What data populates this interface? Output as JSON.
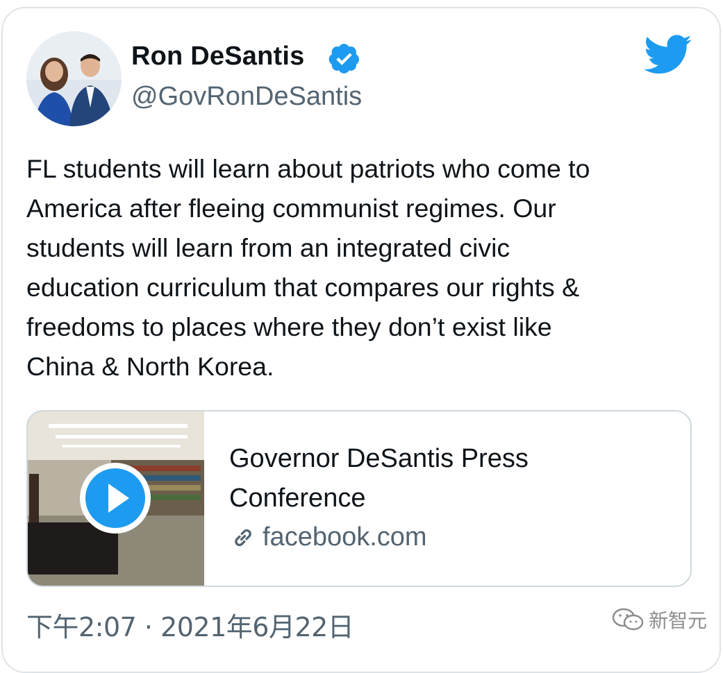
{
  "tweet": {
    "author_name": "Ron DeSantis",
    "handle": "@GovRonDeSantis",
    "verified": true,
    "lines": [
      "FL students will learn about patriots who come to",
      "America after fleeing communist regimes. Our",
      "students will learn from an integrated civic",
      "education curriculum that compares our rights &",
      "freedoms to places where they don’t exist like",
      "China & North Korea."
    ],
    "timestamp": "下午2:07 · 2021年6月22日"
  },
  "link_card": {
    "title_lines": [
      "Governor DeSantis Press",
      "Conference"
    ],
    "domain": "facebook.com"
  },
  "watermark": {
    "text": "新智元"
  },
  "colors": {
    "twitter_blue": "#1d9bf0",
    "verified_blue": "#1d9bf0",
    "secondary_text": "#536471",
    "border": "#cfd9de"
  },
  "icons": {
    "brand": "twitter-bird-icon",
    "verified": "verified-badge-icon",
    "play": "play-icon",
    "link": "link-icon"
  }
}
